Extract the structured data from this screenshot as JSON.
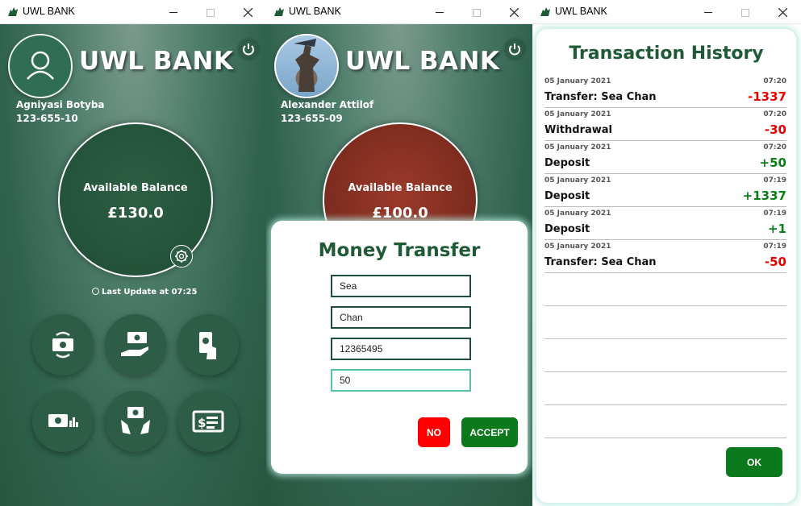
{
  "windows": [
    {
      "title": "UWL BANK"
    },
    {
      "title": "UWL BANK"
    },
    {
      "title": "UWL BANK"
    }
  ],
  "main": {
    "bank_title": "UWL BANK",
    "user_name": "Agniyasi Botyba",
    "account": "123-655-10",
    "balance_label": "Available Balance",
    "balance": "£130.0",
    "last_update": "Last Update at 07:25",
    "actions": [
      "transfer-icon",
      "deposit-icon",
      "withdraw-icon",
      "savings-icon",
      "loan-icon",
      "statement-icon"
    ]
  },
  "transfer": {
    "bank_title": "UWL BANK",
    "user_name": "Alexander Attilof",
    "account": "123-655-09",
    "balance_label": "Available Balance",
    "balance": "£100.0",
    "dialog_title": "Money Transfer",
    "fields": [
      "Sea",
      "Chan",
      "12365495",
      "50"
    ],
    "no_label": "NO",
    "accept_label": "ACCEPT"
  },
  "history": {
    "title": "Transaction History",
    "ok_label": "OK",
    "items": [
      {
        "date": "05 January 2021",
        "time": "07:20",
        "desc": "Transfer: Sea Chan",
        "amount": "-1337",
        "sign": "neg"
      },
      {
        "date": "05 January 2021",
        "time": "07:20",
        "desc": "Withdrawal",
        "amount": "-30",
        "sign": "neg"
      },
      {
        "date": "05 January 2021",
        "time": "07:20",
        "desc": "Deposit",
        "amount": "+50",
        "sign": "pos"
      },
      {
        "date": "05 January 2021",
        "time": "07:19",
        "desc": "Deposit",
        "amount": "+1337",
        "sign": "pos"
      },
      {
        "date": "05 January 2021",
        "time": "07:19",
        "desc": "Deposit",
        "amount": "+1",
        "sign": "pos"
      },
      {
        "date": "05 January 2021",
        "time": "07:19",
        "desc": "Transfer: Sea Chan",
        "amount": "-50",
        "sign": "neg"
      }
    ]
  },
  "colors": {
    "accent_green": "#0c7a1c",
    "title_green": "#1f5a37",
    "negative": "#e60000",
    "positive": "#0b7d17",
    "no_button": "#ff0000"
  }
}
